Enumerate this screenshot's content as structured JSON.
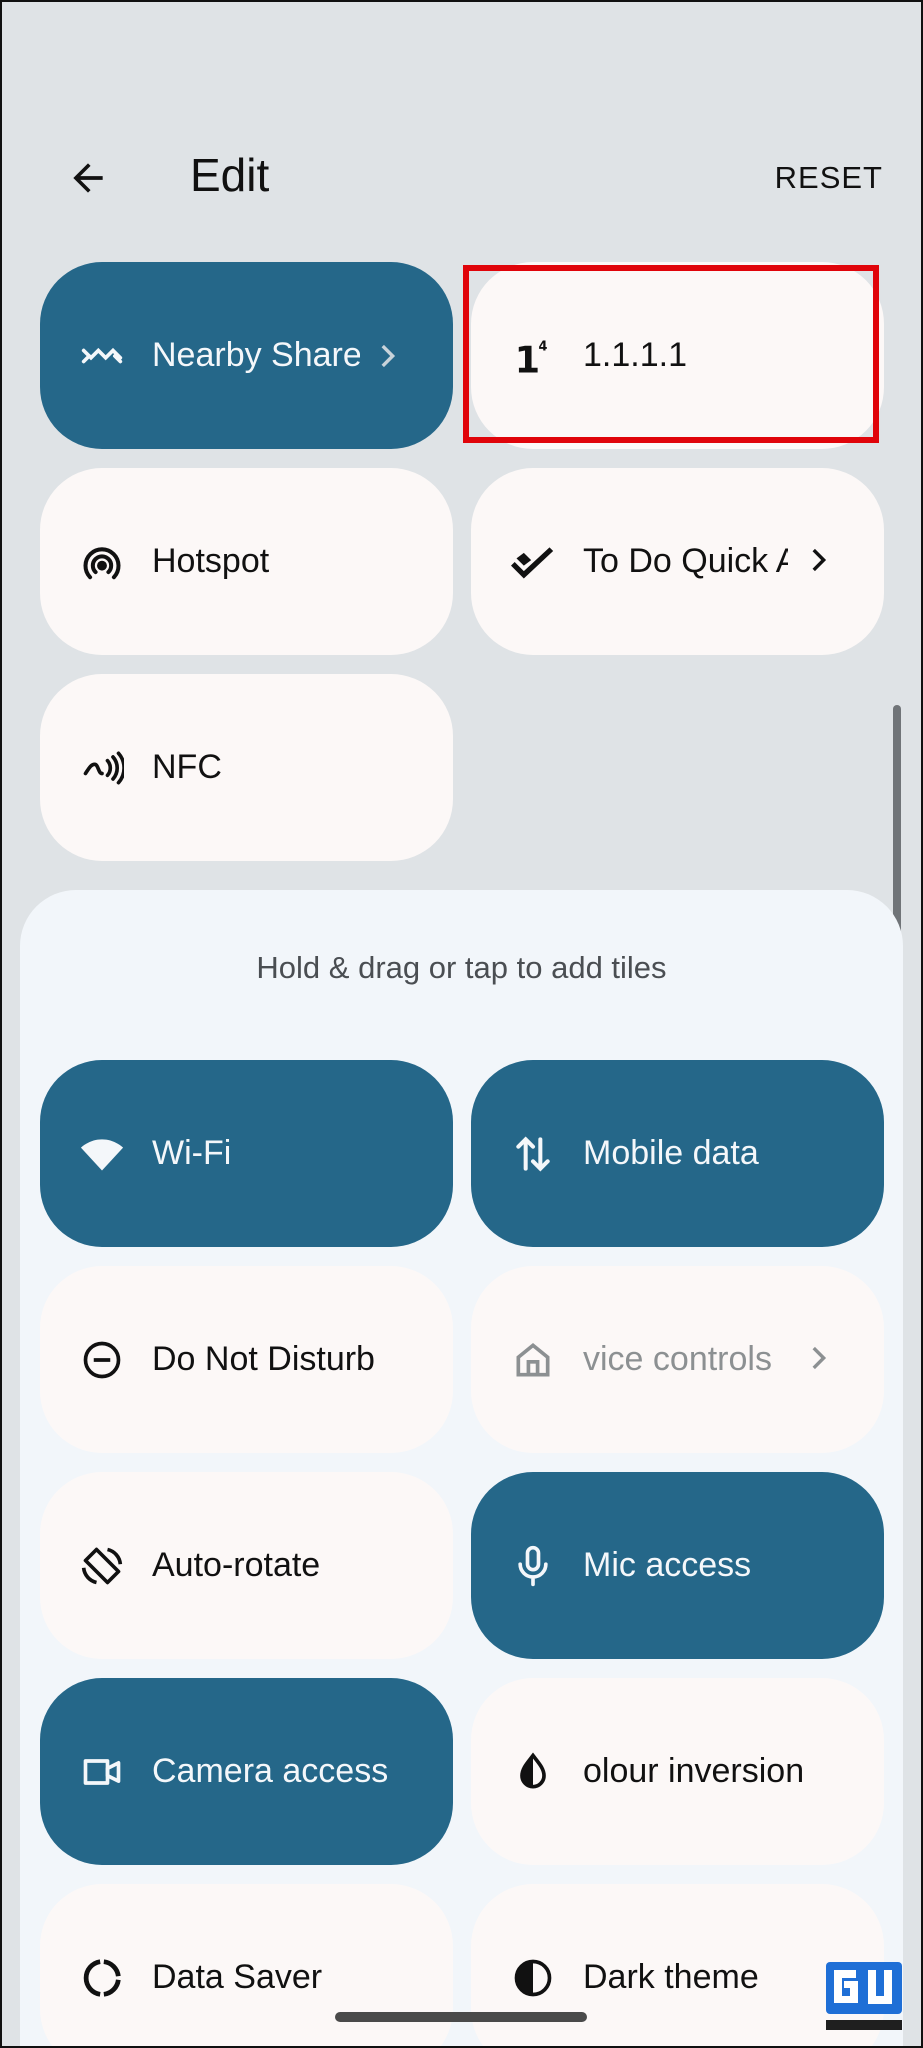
{
  "header": {
    "title": "Edit",
    "reset_label": "RESET"
  },
  "active_tiles": [
    {
      "label": "Nearby Share",
      "icon": "nearby-share-icon",
      "state": "on"
    },
    {
      "label": "1.1.1.1",
      "icon": "one-one-one-one-icon",
      "state": "off"
    },
    {
      "label": "Hotspot",
      "icon": "hotspot-icon",
      "state": "off"
    },
    {
      "label": "To Do Quick Add",
      "icon": "todo-check-icon",
      "state": "off"
    },
    {
      "label": "NFC",
      "icon": "nfc-icon",
      "state": "off"
    }
  ],
  "available": {
    "hint": "Hold & drag or tap to add tiles",
    "tiles": [
      {
        "label": "Wi-Fi",
        "icon": "wifi-icon",
        "state": "on"
      },
      {
        "label": "Mobile data",
        "icon": "mobile-data-icon",
        "state": "on"
      },
      {
        "label": "Do Not Disturb",
        "icon": "do-not-disturb-icon",
        "state": "off"
      },
      {
        "label": "vice controls",
        "icon": "home-icon",
        "state": "unavailable"
      },
      {
        "label": "Auto-rotate",
        "icon": "auto-rotate-icon",
        "state": "off"
      },
      {
        "label": "Mic access",
        "icon": "microphone-icon",
        "state": "on"
      },
      {
        "label": "Camera access",
        "icon": "camera-icon",
        "state": "on"
      },
      {
        "label": "olour inversion",
        "icon": "colour-inversion-icon",
        "state": "off"
      },
      {
        "label": "Data Saver",
        "icon": "data-saver-icon",
        "state": "off"
      },
      {
        "label": "Dark theme",
        "icon": "dark-theme-icon",
        "state": "off"
      }
    ]
  },
  "colors": {
    "tile_on": "#256789",
    "tile_off": "#fcf8f7",
    "highlight": "#e0040a",
    "background": "#dfe3e6",
    "sheet": "#f2f6fa"
  }
}
